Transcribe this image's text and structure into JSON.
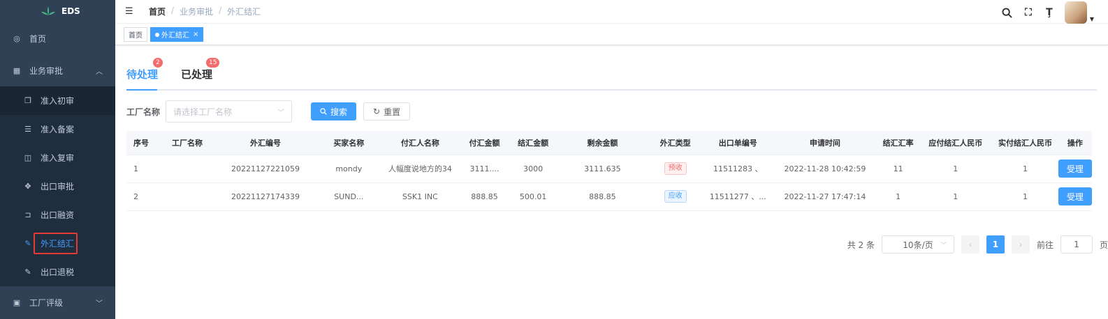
{
  "app": {
    "logo_text": "EDS"
  },
  "sidebar": {
    "items": [
      {
        "label": "首页"
      },
      {
        "label": "业务审批",
        "expanded": true,
        "children": [
          {
            "label": "准入初审"
          },
          {
            "label": "准入备案"
          },
          {
            "label": "准入复审"
          },
          {
            "label": "出口审批"
          },
          {
            "label": "出口融资"
          },
          {
            "label": "外汇结汇",
            "active": true
          },
          {
            "label": "出口退税"
          }
        ]
      },
      {
        "label": "工厂评级",
        "expanded": false
      }
    ]
  },
  "header": {
    "breadcrumb": [
      "首页",
      "业务审批",
      "外汇结汇"
    ],
    "separator": "/"
  },
  "tagsview": {
    "tags": [
      {
        "label": "首页"
      },
      {
        "label": "外汇结汇",
        "active": true,
        "close": "×"
      }
    ]
  },
  "tabs": [
    {
      "label": "待处理",
      "badge": "2",
      "active": true
    },
    {
      "label": "已处理",
      "badge": "15"
    }
  ],
  "filter": {
    "label": "工厂名称",
    "placeholder": "请选择工厂名称",
    "search_label": "搜索",
    "reset_label": "重置"
  },
  "table": {
    "columns": [
      "序号",
      "工厂名称",
      "外汇编号",
      "买家名称",
      "付汇人名称",
      "付汇金额",
      "结汇金额",
      "剩余金额",
      "外汇类型",
      "出口单编号",
      "申请时间",
      "结汇汇率",
      "应付结汇人民币",
      "实付结汇人民币",
      "操作"
    ],
    "rows": [
      {
        "index": "1",
        "factory": "",
        "fx_no": "20221127221059",
        "buyer": "mondy",
        "payer": "人幅度说地方的34",
        "pay_amount": "3111....",
        "settle_amount": "3000",
        "remaining": "3111.635",
        "fx_type": "预收",
        "export_no": "11511283 、",
        "apply_time": "2022-11-28 10:42:59",
        "rate": "11",
        "payable_rmb": "1",
        "paid_rmb": "1",
        "action": "受理"
      },
      {
        "index": "2",
        "factory": "",
        "fx_no": "20221127174339",
        "buyer": "SUND...",
        "payer": "SSK1 INC",
        "pay_amount": "888.85",
        "settle_amount": "500.01",
        "remaining": "888.85",
        "fx_type": "应收",
        "export_no": "11511277 、...",
        "apply_time": "2022-11-27 17:47:14",
        "rate": "1",
        "payable_rmb": "1",
        "paid_rmb": "1",
        "action": "受理"
      }
    ]
  },
  "pagination": {
    "total_text": "共 2 条",
    "page_size": "10条/页",
    "prev": "‹",
    "current_page": "1",
    "next": "›",
    "goto_label": "前往",
    "goto_value": "1",
    "page_suffix": "页"
  },
  "colors": {
    "primary": "#409eff",
    "sidebar_bg": "#304156",
    "danger": "#f56c6c"
  }
}
